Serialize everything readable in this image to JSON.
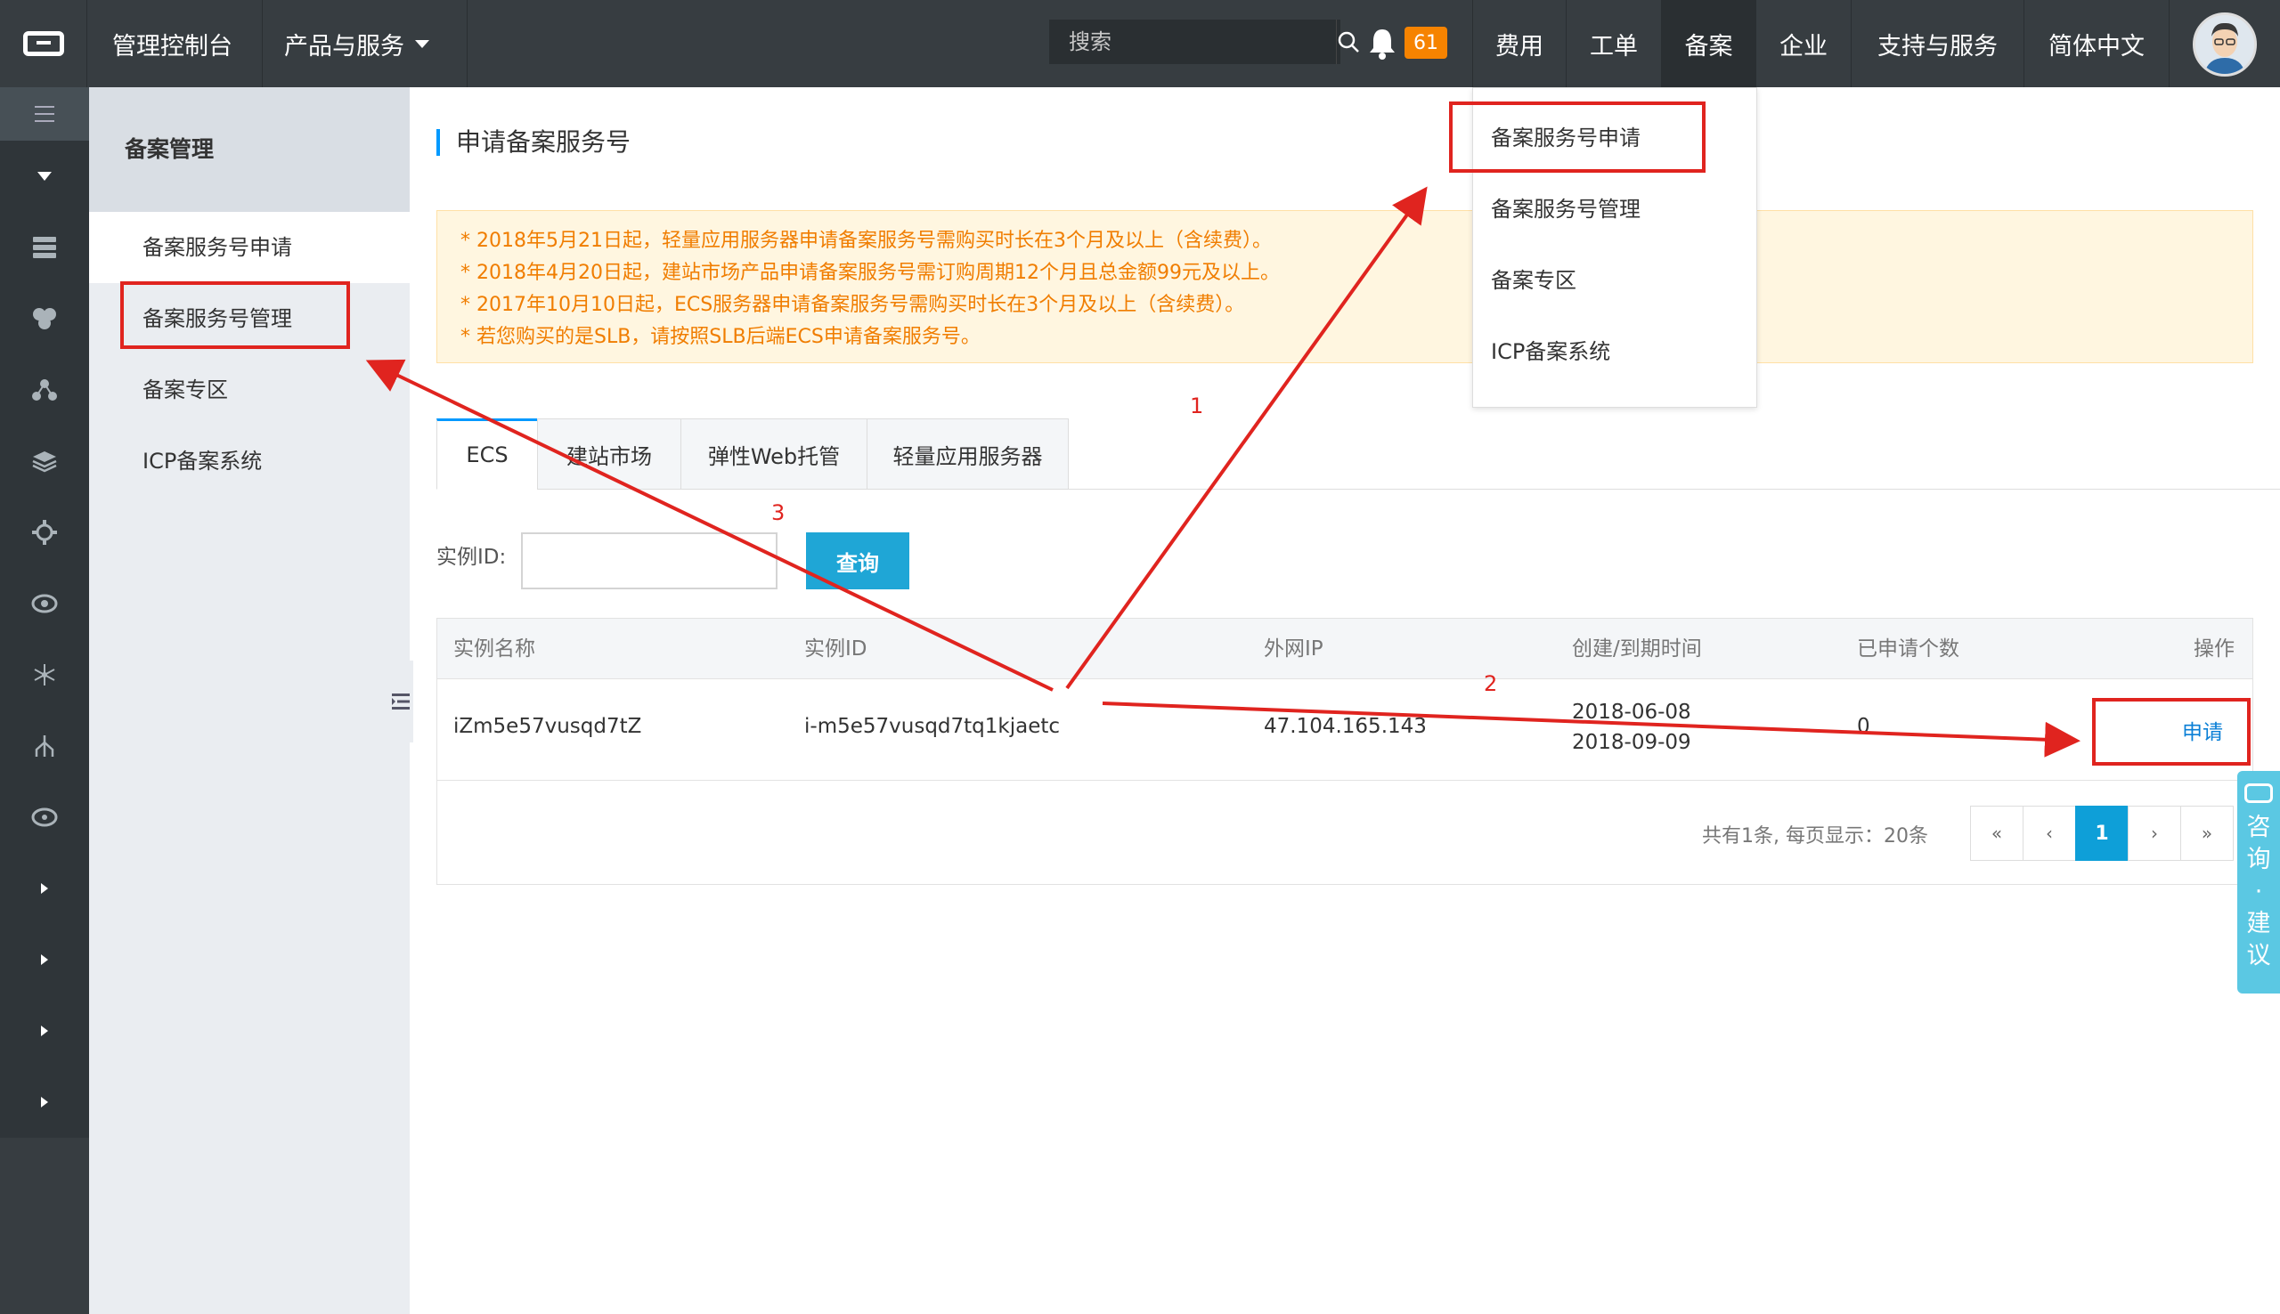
{
  "topbar": {
    "console_label": "管理控制台",
    "products_label": "产品与服务",
    "search_placeholder": "搜索",
    "notification_count": "61",
    "nav": [
      "费用",
      "工单",
      "备案",
      "企业",
      "支持与服务",
      "简体中文"
    ]
  },
  "subnav": {
    "title": "备案管理",
    "items": [
      "备案服务号申请",
      "备案服务号管理",
      "备案专区",
      "ICP备案系统"
    ]
  },
  "main": {
    "page_title": "申请备案服务号",
    "notices": [
      "* 2018年5月21日起，轻量应用服务器申请备案服务号需购买时长在3个月及以上（含续费）。",
      "* 2018年4月20日起，建站市场产品申请备案服务号需订购周期12个月且总金额99元及以上。",
      "* 2017年10月10日起，ECS服务器申请备案服务号需购买时长在3个月及以上（含续费）。",
      "* 若您购买的是SLB，请按照SLB后端ECS申请备案服务号。"
    ],
    "tabs": [
      "ECS",
      "建站市场",
      "弹性Web托管",
      "轻量应用服务器"
    ],
    "instance_label": "实例ID:",
    "instance_value": "",
    "query_label": "查询",
    "table": {
      "headers": [
        "实例名称",
        "实例ID",
        "外网IP",
        "创建/到期时间",
        "已申请个数",
        "操作"
      ],
      "rows": [
        {
          "name": "iZm5e57vusqd7tZ",
          "id": "i-m5e57vusqd7tq1kjaetc",
          "ip": "47.104.165.143",
          "created": "2018-06-08",
          "expires": "2018-09-09",
          "count": "0",
          "action": "申请"
        }
      ]
    },
    "pager": {
      "info": "共有1条, 每页显示：20条",
      "first": "«",
      "prev": "‹",
      "current": "1",
      "next": "›",
      "last": "»"
    }
  },
  "dropdown": {
    "items": [
      "备案服务号申请",
      "备案服务号管理",
      "备案专区",
      "ICP备案系统"
    ]
  },
  "annotations": [
    "1",
    "2",
    "3"
  ],
  "consult": {
    "label": "咨询·建议"
  },
  "colors": {
    "topbar": "#373d41",
    "accent": "#0099ff",
    "annotation": "#e0241f",
    "notice_text": "#f07d00",
    "badge": "#f68300"
  }
}
